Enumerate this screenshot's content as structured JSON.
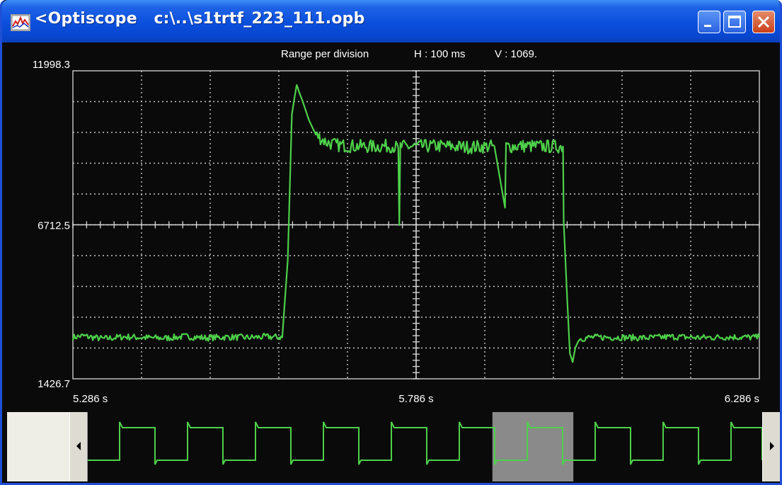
{
  "window": {
    "title": "<Optiscope   c:\\..\\s1trtf_223_111.opb",
    "buttons": [
      "minimize",
      "maximize",
      "close"
    ],
    "icons": {
      "app": "oscilloscope-app-icon",
      "minimize": "minimize-icon",
      "maximize": "maximize-icon",
      "close": "close-icon"
    }
  },
  "scope": {
    "header_label": "Range per division",
    "h_range": "H : 100 ms",
    "v_range": "V : 1069.",
    "colors": {
      "background": "#0a0a0a",
      "trace": "#4ed04a",
      "grid": "#c8c8c8",
      "text": "#ffffff"
    }
  },
  "chart_data": {
    "type": "line",
    "x_unit": "s",
    "xlim": [
      5.286,
      6.286
    ],
    "ylim": [
      1426.7,
      11998.3
    ],
    "x_tick_labels": [
      "5.286 s",
      "5.786 s",
      "6.286 s"
    ],
    "y_tick_labels": [
      "11998.3",
      "6712.5",
      "1426.7"
    ],
    "grid": true,
    "series": [
      {
        "color": "#4ed04a",
        "x": [
          5.286,
          5.3,
          5.33,
          5.36,
          5.39,
          5.42,
          5.45,
          5.48,
          5.51,
          5.54,
          5.57,
          5.591,
          5.599,
          5.605,
          5.609,
          5.612,
          5.615,
          5.62,
          5.63,
          5.64,
          5.655,
          5.67,
          5.69,
          5.72,
          5.75,
          5.76,
          5.7615,
          5.763,
          5.78,
          5.82,
          5.86,
          5.9,
          5.9155,
          5.917,
          5.9185,
          5.94,
          5.98,
          6.0,
          6.001,
          6.006,
          6.01,
          6.014,
          6.018,
          6.024,
          6.04,
          6.08,
          6.12,
          6.16,
          6.2,
          6.24,
          6.286
        ],
        "y": [
          2850,
          2900,
          2800,
          2870,
          2840,
          2820,
          2880,
          2830,
          2860,
          2840,
          2870,
          2850,
          5500,
          10500,
          11100,
          11500,
          11300,
          11000,
          10300,
          9800,
          9550,
          9450,
          9420,
          9400,
          9420,
          9350,
          6700,
          9400,
          9400,
          9420,
          9380,
          9410,
          7300,
          9400,
          9400,
          9420,
          9400,
          9400,
          6800,
          4200,
          2300,
          2000,
          2500,
          2800,
          2850,
          2850,
          2830,
          2870,
          2840,
          2860,
          2850
        ]
      }
    ]
  },
  "overview": {
    "scroll_left_icon": "scroll-left-arrow-icon",
    "scroll_right_icon": "scroll-right-arrow-icon",
    "thumb_start_fraction": 0.6,
    "thumb_end_fraction": 0.72
  }
}
